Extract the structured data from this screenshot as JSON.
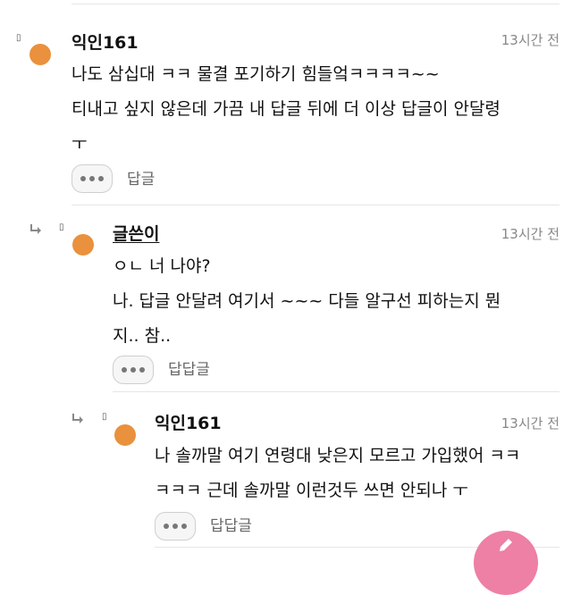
{
  "comments": [
    {
      "author": "익인161",
      "time": "13시간 전",
      "text": "나도 삼십대 ㅋㅋ 물결 포기하기 힘들엌ㅋㅋㅋㅋ~~\n티내고 싶지 않은데 가끔 내 답글 뒤에 더 이상 답글이 안달령\nㅜ",
      "reply_label": "답글"
    },
    {
      "author": "글쓴이",
      "time": "13시간 전",
      "text": "ㅇㄴ 너 나야?\n나. 답글 안달려 여기서 ~~~ 다들 알구선 피하는지 뭔\n지.. 참..",
      "reply_label": "답답글"
    },
    {
      "author": "익인161",
      "time": "13시간 전",
      "text": "나 솔까말 여기 연령대 낮은지 모르고 가입했어 ㅋㅋ\nㅋㅋㅋ 근데 솔까말 이런것두 쓰면 안되나 ㅜ",
      "reply_label": "답답글"
    }
  ],
  "icons": {
    "avatar_color": "#e9913d",
    "fab_color": "#ee7fa5",
    "marker_glyph": "▯"
  }
}
